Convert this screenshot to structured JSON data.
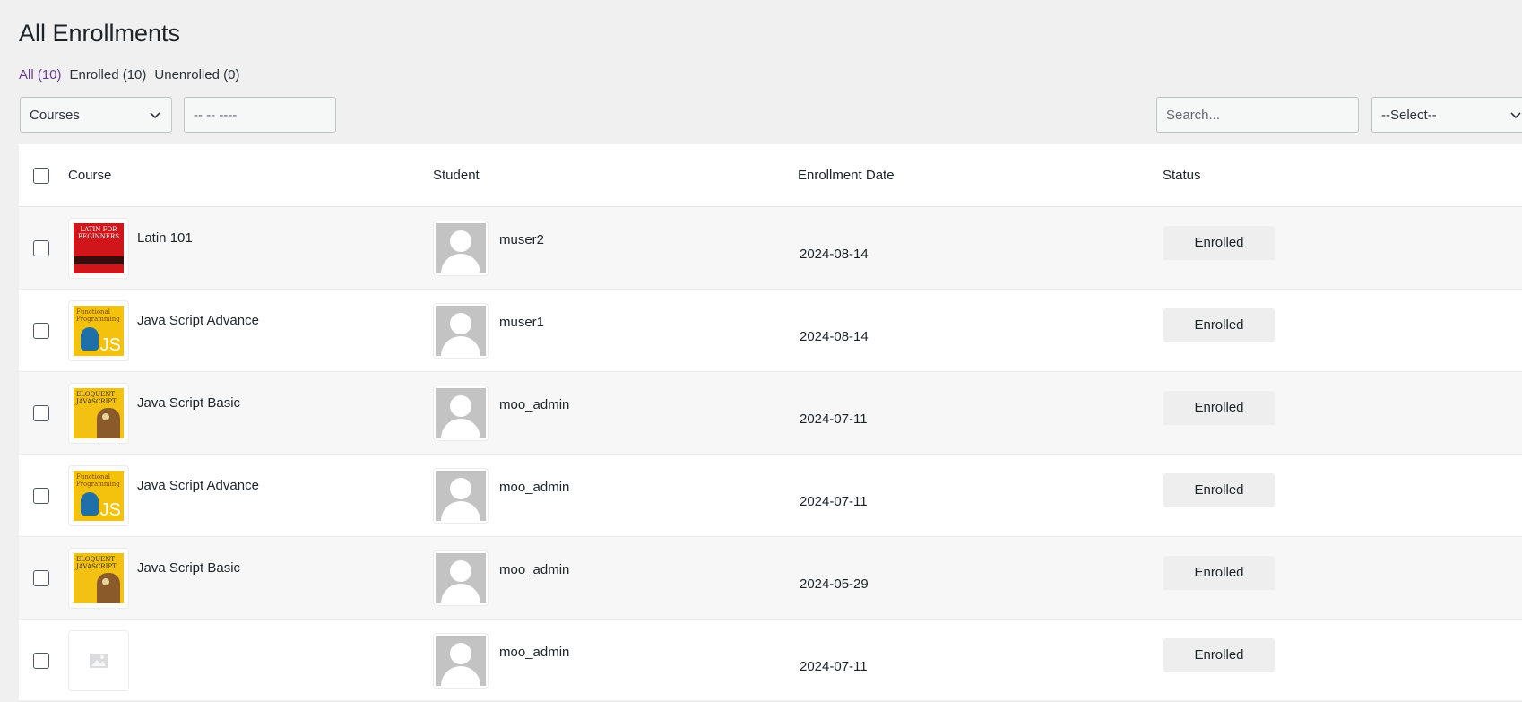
{
  "page": {
    "title": "All Enrollments"
  },
  "views": [
    {
      "label": "All (10)",
      "current": true
    },
    {
      "label": "Enrolled (10)",
      "current": false
    },
    {
      "label": "Unenrolled (0)",
      "current": false
    }
  ],
  "filters": {
    "course_select": "Courses",
    "date_placeholder": "-- -- ----",
    "search_placeholder": "Search...",
    "status_select": "--Select--"
  },
  "table": {
    "columns": [
      "Course",
      "Student",
      "Enrollment Date",
      "Status"
    ],
    "rows": [
      {
        "course": "Latin 101",
        "cover": "latin",
        "student": "muser2",
        "date": "2024-08-14",
        "status": "Enrolled"
      },
      {
        "course": "Java Script Advance",
        "cover": "adv",
        "student": "muser1",
        "date": "2024-08-14",
        "status": "Enrolled"
      },
      {
        "course": "Java Script Basic",
        "cover": "basic",
        "student": "moo_admin",
        "date": "2024-07-11",
        "status": "Enrolled"
      },
      {
        "course": "Java Script Advance",
        "cover": "adv",
        "student": "moo_admin",
        "date": "2024-07-11",
        "status": "Enrolled"
      },
      {
        "course": "Java Script Basic",
        "cover": "basic",
        "student": "moo_admin",
        "date": "2024-05-29",
        "status": "Enrolled"
      },
      {
        "course": "",
        "cover": "none",
        "student": "moo_admin",
        "date": "2024-07-11",
        "status": "Enrolled"
      }
    ]
  },
  "covers": {
    "latin": "LATIN FOR BEGINNERS",
    "adv_title": "Functional Programming",
    "adv_badge": "JS",
    "basic": "ELOQUENT JAVASCRIPT"
  }
}
